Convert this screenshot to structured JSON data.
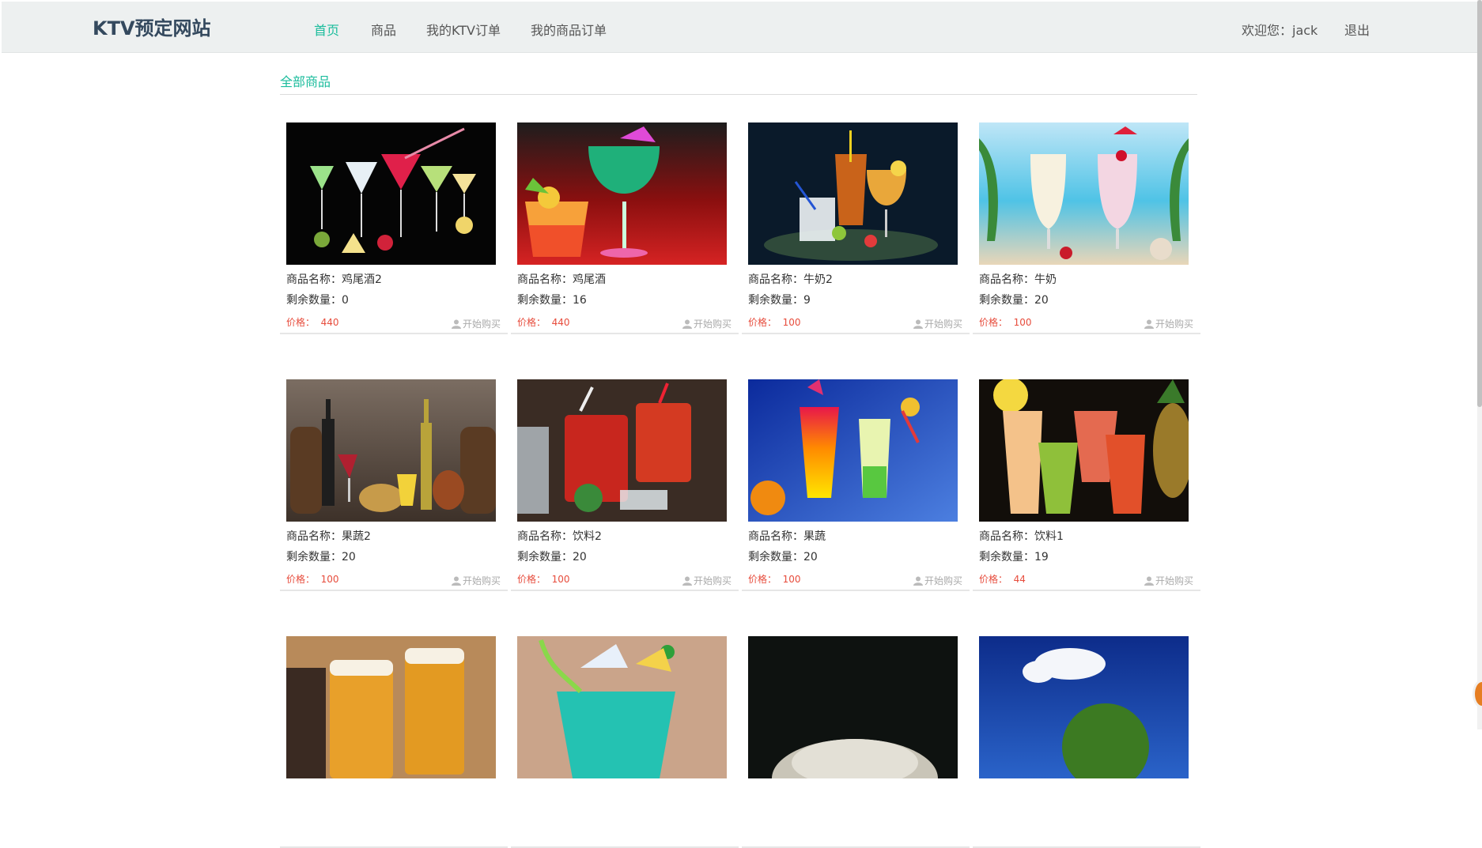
{
  "header": {
    "brand": "KTV预定网站",
    "nav": [
      "首页",
      "商品",
      "我的KTV订单",
      "我的商品订单"
    ],
    "welcome": "欢迎您：jack",
    "logout": "退出"
  },
  "section_title": "全部商品",
  "labels": {
    "name": "商品名称：",
    "stock": "剩余数量：",
    "price": "价格：",
    "buy": "开始购买"
  },
  "products": [
    {
      "name": "鸡尾酒2",
      "stock": "0",
      "price": "440"
    },
    {
      "name": "鸡尾酒",
      "stock": "16",
      "price": "440"
    },
    {
      "name": "牛奶2",
      "stock": "9",
      "price": "100"
    },
    {
      "name": "牛奶",
      "stock": "20",
      "price": "100"
    },
    {
      "name": "果蔬2",
      "stock": "20",
      "price": "100"
    },
    {
      "name": "饮料2",
      "stock": "20",
      "price": "100"
    },
    {
      "name": "果蔬",
      "stock": "20",
      "price": "100"
    },
    {
      "name": "饮料1",
      "stock": "19",
      "price": "44"
    },
    {
      "name": "",
      "stock": "",
      "price": ""
    },
    {
      "name": "",
      "stock": "",
      "price": ""
    },
    {
      "name": "",
      "stock": "",
      "price": ""
    },
    {
      "name": "",
      "stock": "",
      "price": ""
    }
  ],
  "colors": {
    "accent": "#1abc9c",
    "price": "#e74c3c",
    "navbar": "#edf0f0"
  }
}
